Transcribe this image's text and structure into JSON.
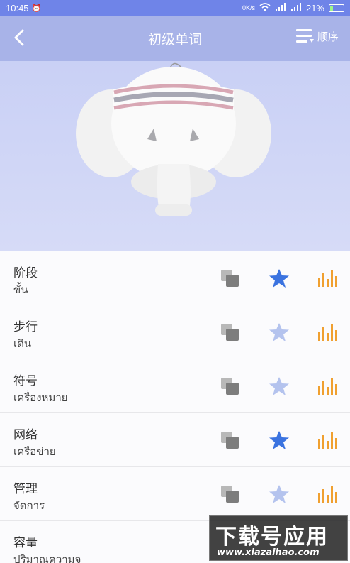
{
  "status_bar": {
    "time": "10:45",
    "network": "0K/s",
    "battery": "21%"
  },
  "header": {
    "title": "初级单词",
    "order_label": "顺序"
  },
  "words": [
    {
      "zh": "阶段",
      "th": "ขั้น",
      "starred": true
    },
    {
      "zh": "步行",
      "th": "เดิน",
      "starred": false
    },
    {
      "zh": "符号",
      "th": "เครื่องหมาย",
      "starred": false
    },
    {
      "zh": "网络",
      "th": "เครือข่าย",
      "starred": true
    },
    {
      "zh": "管理",
      "th": "จัดการ",
      "starred": false
    },
    {
      "zh": "容量",
      "th": "ปริมาณความจุ",
      "starred": false
    }
  ],
  "watermark": {
    "title": "下载号应用",
    "url": "www.xiazaihao.com"
  },
  "colors": {
    "accent": "#6f84e8",
    "star_active": "#3b73e0",
    "star_inactive": "#b4c3ee",
    "level_icon": "#f0a030",
    "copy_icon": "#7d7d7d"
  }
}
